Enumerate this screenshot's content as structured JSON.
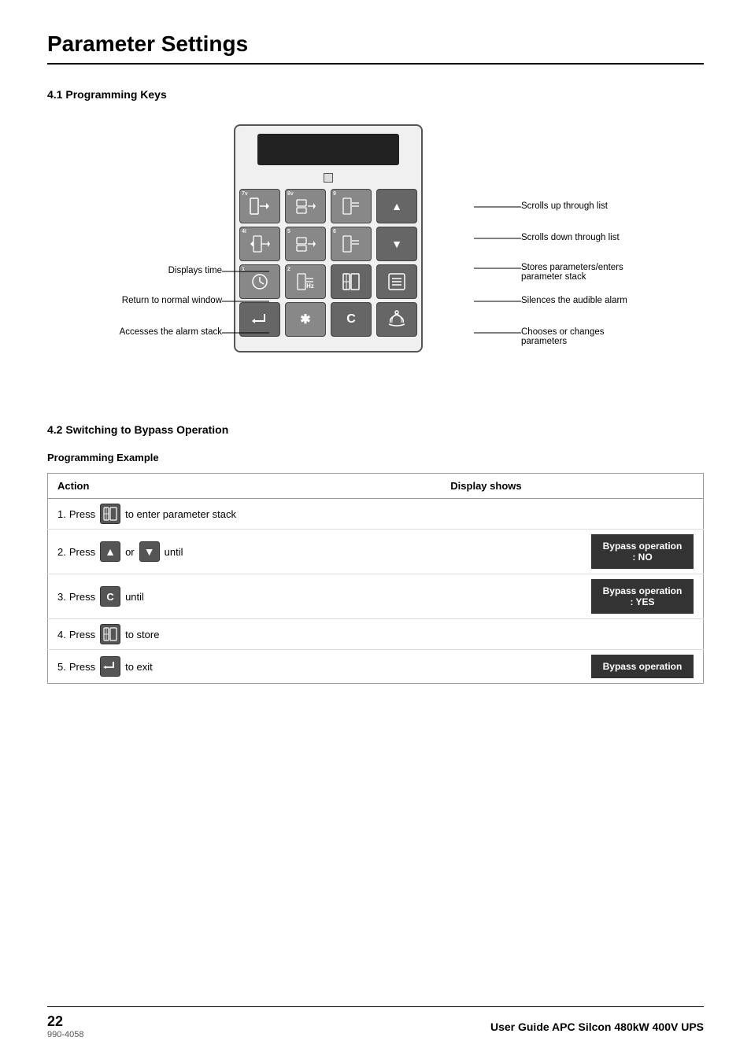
{
  "page": {
    "title": "Parameter Settings",
    "doc_number": "990-4058",
    "page_number": "22",
    "footer_title": "User Guide APC Silcon 480kW 400V UPS"
  },
  "section_4_1": {
    "heading": "4.1    Programming Keys",
    "annotations_right": [
      {
        "id": "scrolls-up",
        "text": "Scrolls up through list",
        "top_pct": 37
      },
      {
        "id": "scrolls-down",
        "text": "Scrolls down through list",
        "top_pct": 47
      },
      {
        "id": "stores-params",
        "text": "Stores parameters/enters parameter stack",
        "top_pct": 57
      },
      {
        "id": "silences-alarm",
        "text": "Silences the audible alarm",
        "top_pct": 68
      },
      {
        "id": "chooses-changes",
        "text": "Chooses or changes parameters",
        "top_pct": 80
      }
    ],
    "annotations_left": [
      {
        "id": "displays-time",
        "text": "Displays time",
        "top_pct": 55
      },
      {
        "id": "return-normal",
        "text": "Return to normal window",
        "top_pct": 65
      },
      {
        "id": "accesses-alarm",
        "text": "Accesses the alarm stack",
        "top_pct": 78
      }
    ]
  },
  "section_4_2": {
    "heading": "4.2    Switching to Bypass Operation",
    "sub_heading": "Programming Example",
    "table": {
      "col_action": "Action",
      "col_display": "Display shows",
      "rows": [
        {
          "step": "1.",
          "press_label": "Press",
          "icon": "store",
          "text": "to enter parameter stack",
          "display": null
        },
        {
          "step": "2.",
          "press_label": "Press",
          "icon": "up",
          "text_mid": "or",
          "icon2": "down",
          "text": "until",
          "display": "Bypass operation\n: NO"
        },
        {
          "step": "3.",
          "press_label": "Press",
          "icon": "c",
          "text": "until",
          "display": "Bypass operation\n: YES"
        },
        {
          "step": "4.",
          "press_label": "Press",
          "icon": "store",
          "text": "to store",
          "display": null
        },
        {
          "step": "5.",
          "press_label": "Press",
          "icon": "enter",
          "text": "to exit",
          "display": "Bypass operation"
        }
      ]
    }
  }
}
